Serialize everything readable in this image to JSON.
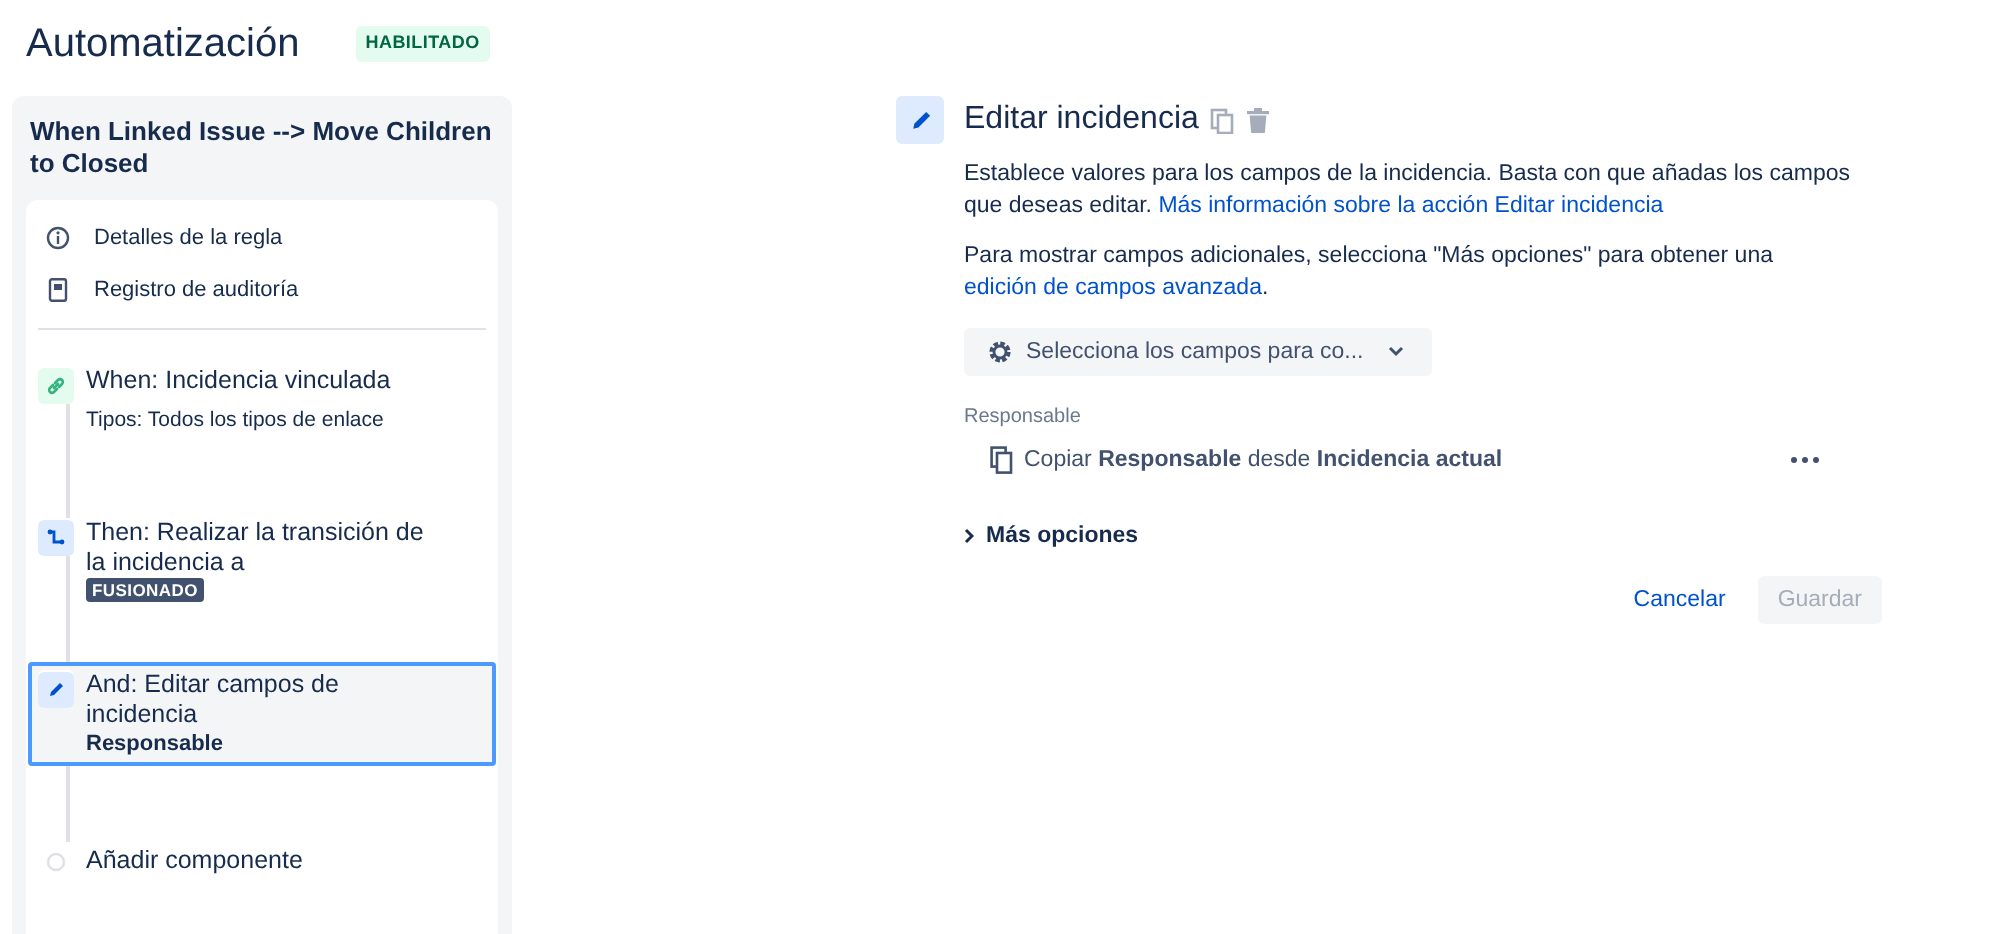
{
  "header": {
    "title": "Automatización",
    "status": "HABILITADO"
  },
  "rule": {
    "name": "When Linked Issue --> Move Children to Closed",
    "menu": [
      {
        "kind": "info",
        "label": "Detalles de la regla"
      },
      {
        "kind": "log",
        "label": "Registro de auditoría"
      }
    ],
    "components": [
      {
        "kind": "trigger",
        "title": "When: Incidencia vinculada",
        "detail": "Tipos: Todos los tipos de enlace",
        "selected": false
      },
      {
        "kind": "transition",
        "title": "Then: Realizar la transición de la incidencia a",
        "lozenge": "FUSIONADO",
        "selected": false
      },
      {
        "kind": "edit",
        "title": "And: Editar campos de incidencia",
        "field": "Responsable",
        "selected": true
      },
      {
        "kind": "add",
        "title": "Añadir componente",
        "selected": false
      }
    ]
  },
  "editor": {
    "title": "Editar incidencia",
    "description": "Establece valores para los campos de la incidencia. Basta con que añadas los campos que deseas editar.",
    "description_link": "Más información sobre la acción Editar incidencia",
    "note": "Para mostrar campos adicionales, selecciona \"Más opciones\" para obtener una",
    "note_link": "edición de campos avanzada",
    "note_end": ".",
    "field_picker": "Selecciona los campos para co...",
    "fields": [
      {
        "label": "Responsable",
        "value": "Copiar **Responsable** desde **Incidencia actual**"
      }
    ],
    "more_options": {
      "label": "Más opciones",
      "expanded": false
    },
    "buttons": [
      {
        "kind": "link",
        "label": "Cancelar",
        "disabled": false
      },
      {
        "kind": "primary",
        "label": "Guardar",
        "disabled": true
      }
    ]
  }
}
